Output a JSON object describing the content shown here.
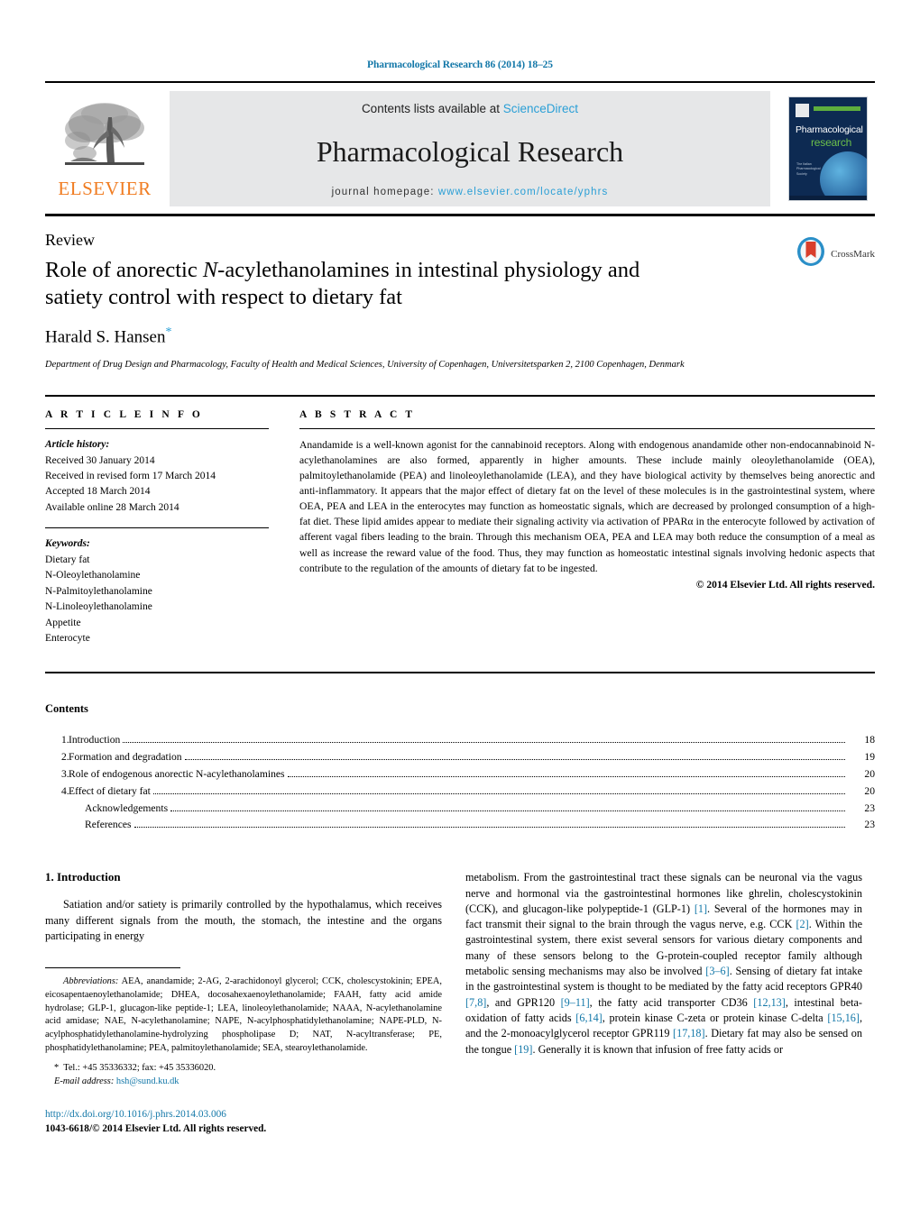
{
  "running_head": "Pharmacological Research 86 (2014) 18–25",
  "masthead": {
    "publisher_name": "ELSEVIER",
    "contents_prefix": "Contents lists available at ",
    "sciencedirect": "ScienceDirect",
    "journal_name": "Pharmacological Research",
    "homepage_prefix": "journal homepage: ",
    "homepage_url": "www.elsevier.com/locate/yphrs",
    "cover": {
      "title_line1": "Pharmacological",
      "title_line2": "research",
      "society_text": "The Italian Pharmacological Society"
    }
  },
  "article": {
    "type": "Review",
    "title_part1": "Role of anorectic ",
    "title_italic": "N",
    "title_part2": "-acylethanolamines in intestinal physiology and satiety control with respect to dietary fat",
    "author": "Harald S. Hansen",
    "author_star": "*",
    "affiliation": "Department of Drug Design and Pharmacology, Faculty of Health and Medical Sciences, University of Copenhagen, Universitetsparken 2, 2100 Copenhagen, Denmark",
    "crossmark_label": "CrossMark"
  },
  "article_info": {
    "heading": "A R T I C L E   I N F O",
    "history_label": "Article history:",
    "history": [
      "Received 30 January 2014",
      "Received in revised form 17 March 2014",
      "Accepted 18 March 2014",
      "Available online 28 March 2014"
    ],
    "keywords_label": "Keywords:",
    "keywords": [
      "Dietary fat",
      "N-Oleoylethanolamine",
      "N-Palmitoylethanolamine",
      "N-Linoleoylethanolamine",
      "Appetite",
      "Enterocyte"
    ]
  },
  "abstract": {
    "heading": "A B S T R A C T",
    "text": "Anandamide is a well-known agonist for the cannabinoid receptors. Along with endogenous anandamide other non-endocannabinoid N-acylethanolamines are also formed, apparently in higher amounts. These include mainly oleoylethanolamide (OEA), palmitoylethanolamide (PEA) and linoleoylethanolamide (LEA), and they have biological activity by themselves being anorectic and anti-inflammatory. It appears that the major effect of dietary fat on the level of these molecules is in the gastrointestinal system, where OEA, PEA and LEA in the enterocytes may function as homeostatic signals, which are decreased by prolonged consumption of a high-fat diet. These lipid amides appear to mediate their signaling activity via activation of PPARα in the enterocyte followed by activation of afferent vagal fibers leading to the brain. Through this mechanism OEA, PEA and LEA may both reduce the consumption of a meal as well as increase the reward value of the food. Thus, they may function as homeostatic intestinal signals involving hedonic aspects that contribute to the regulation of the amounts of dietary fat to be ingested.",
    "copyright": "© 2014 Elsevier Ltd. All rights reserved."
  },
  "contents": {
    "heading": "Contents",
    "entries": [
      {
        "num": "1.",
        "label": "Introduction",
        "page": "18",
        "indent": false
      },
      {
        "num": "2.",
        "label": "Formation and degradation",
        "page": "19",
        "indent": false
      },
      {
        "num": "3.",
        "label": "Role of endogenous anorectic N-acylethanolamines",
        "page": "20",
        "indent": false
      },
      {
        "num": "4.",
        "label": "Effect of dietary fat",
        "page": "20",
        "indent": false
      },
      {
        "num": "",
        "label": "Acknowledgements",
        "page": "23",
        "indent": true
      },
      {
        "num": "",
        "label": "References",
        "page": "23",
        "indent": true
      }
    ]
  },
  "body": {
    "section_heading": "1.  Introduction",
    "left_paragraph": "Satiation and/or satiety is primarily controlled by the hypothalamus, which receives many different signals from the mouth, the stomach, the intestine and the organs participating in energy",
    "right_paragraph_a": "metabolism. From the gastrointestinal tract these signals can be neuronal via the vagus nerve and hormonal via the gastrointestinal hormones like ghrelin, cholescystokinin (CCK), and glucagon-like polypeptide-1 (GLP-1) ",
    "ref1": "[1]",
    "right_paragraph_b": ". Several of the hormones may in fact transmit their signal to the brain through the vagus nerve, e.g. CCK ",
    "ref2": "[2]",
    "right_paragraph_c": ". Within the gastrointestinal system, there exist several sensors for various dietary components and many of these sensors belong to the G-protein-coupled receptor family although metabolic sensing mechanisms may also be involved ",
    "ref3": "[3–6]",
    "right_paragraph_d": ". Sensing of dietary fat intake in the gastrointestinal system is thought to be mediated by the fatty acid receptors GPR40 ",
    "ref4": "[7,8]",
    "right_paragraph_e": ", and GPR120 ",
    "ref5": "[9–11]",
    "right_paragraph_f": ", the fatty acid transporter CD36 ",
    "ref6": "[12,13]",
    "right_paragraph_g": ", intestinal beta-oxidation of fatty acids ",
    "ref7": "[6,14]",
    "right_paragraph_h": ", protein kinase C-zeta or protein kinase C-delta ",
    "ref8": "[15,16]",
    "right_paragraph_i": ", and the 2-monoacylglycerol receptor GPR119 ",
    "ref9": "[17,18]",
    "right_paragraph_j": ". Dietary fat may also be sensed on the tongue ",
    "ref10": "[19]",
    "right_paragraph_k": ". Generally it is known that infusion of free fatty acids or"
  },
  "footnotes": {
    "abbrev_label": "Abbreviations:",
    "abbrev_text": "  AEA, anandamide; 2-AG, 2-arachidonoyl glycerol; CCK, cholescystokinin; EPEA, eicosapentaenoylethanolamide; DHEA, docosahexaenoylethanolamide; FAAH, fatty acid amide hydrolase; GLP-1, glucagon-like peptide-1; LEA, linoleoylethanolamide; NAAA, N-acylethanolamine acid amidase; NAE, N-acylethanolamine; NAPE, N-acylphosphatidylethanolamine; NAPE-PLD, N-acylphosphatidylethanolamine-hydrolyzing phospholipase D; NAT, N-acyltransferase; PE, phosphatidylethanolamine; PEA, palmitoylethanolamide; SEA, stearoylethanolamide.",
    "tel_line": "Tel.: +45 35336332; fax: +45 35336020.",
    "email_label": "E-mail address:",
    "email": "hsh@sund.ku.dk",
    "doi_url": "http://dx.doi.org/10.1016/j.phrs.2014.03.006",
    "issn_line": "1043-6618/© 2014 Elsevier Ltd. All rights reserved."
  },
  "colors": {
    "link_blue": "#1277a8",
    "sciencedirect_blue": "#2a9fd6",
    "elsevier_orange": "#f07c21",
    "cover_navy": "#0d2a52",
    "cover_green": "#6cc04a",
    "band_gray": "#e6e7e8"
  }
}
